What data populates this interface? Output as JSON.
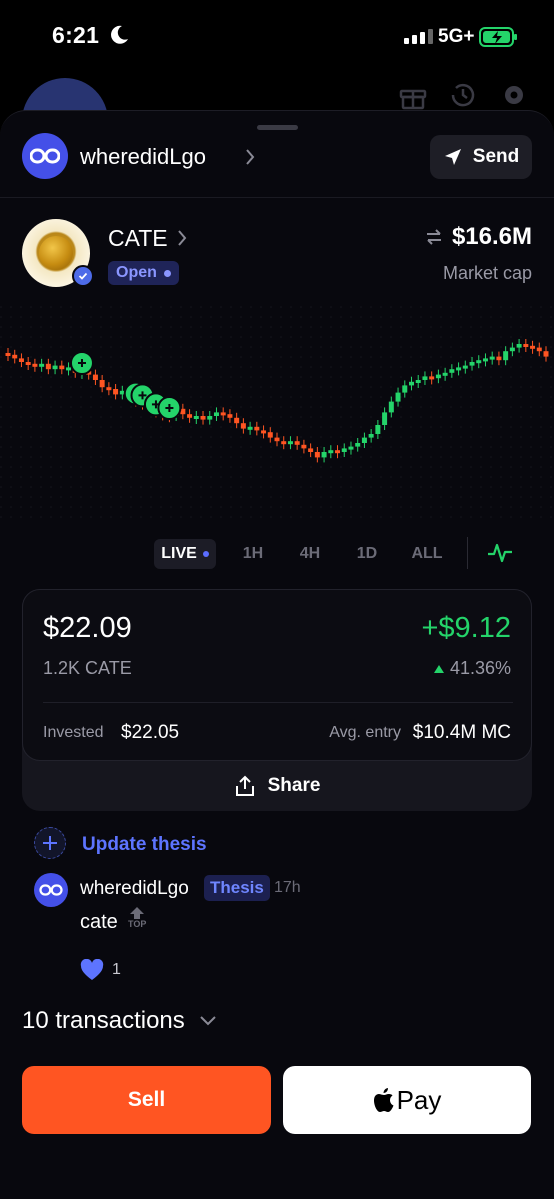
{
  "status_bar": {
    "time": "6:21",
    "network": "5G+"
  },
  "account": {
    "name": "wheredidLgo",
    "send_label": "Send"
  },
  "token": {
    "name": "CATE",
    "status": "Open",
    "market_cap": "$16.6M",
    "market_cap_label": "Market cap"
  },
  "timeframes": [
    "LIVE",
    "1H",
    "4H",
    "1D",
    "ALL"
  ],
  "position": {
    "value": "$22.09",
    "quantity": "1.2K CATE",
    "pnl": "+$9.12",
    "pnl_percent": "41.36%",
    "invested_label": "Invested",
    "invested_value": "$22.05",
    "avg_entry_label": "Avg. entry",
    "avg_entry_value": "$10.4M MC",
    "share_label": "Share"
  },
  "thesis": {
    "update_label": "Update thesis",
    "author": "wheredidLgo",
    "tag": "Thesis",
    "time": "17h",
    "body": "cate",
    "top_badge": "TOP",
    "likes": "1"
  },
  "transactions": {
    "label": "10 transactions"
  },
  "actions": {
    "sell_label": "Sell",
    "pay_label": "Pay"
  },
  "colors": {
    "up": "#24d46a",
    "down": "#ff5522",
    "accent": "#5d74ff"
  },
  "chart_data": {
    "type": "candlestick",
    "candles": [
      0.84,
      0.82,
      0.8,
      0.79,
      0.78,
      0.79,
      0.76,
      0.78,
      0.76,
      0.77,
      0.74,
      0.75,
      0.73,
      0.7,
      0.66,
      0.65,
      0.62,
      0.64,
      0.61,
      0.58,
      0.57,
      0.55,
      0.52,
      0.51,
      0.5,
      0.54,
      0.51,
      0.49,
      0.5,
      0.48,
      0.5,
      0.52,
      0.51,
      0.49,
      0.46,
      0.43,
      0.44,
      0.42,
      0.41,
      0.38,
      0.36,
      0.35,
      0.36,
      0.34,
      0.32,
      0.3,
      0.27,
      0.3,
      0.31,
      0.3,
      0.32,
      0.33,
      0.35,
      0.38,
      0.4,
      0.45,
      0.52,
      0.58,
      0.63,
      0.67,
      0.69,
      0.7,
      0.72,
      0.71,
      0.73,
      0.74,
      0.76,
      0.77,
      0.78,
      0.8,
      0.81,
      0.82,
      0.83,
      0.81,
      0.86,
      0.88,
      0.9,
      0.89,
      0.88,
      0.86,
      0.83
    ],
    "buy_markers": [
      11,
      19,
      20,
      22,
      24
    ]
  }
}
